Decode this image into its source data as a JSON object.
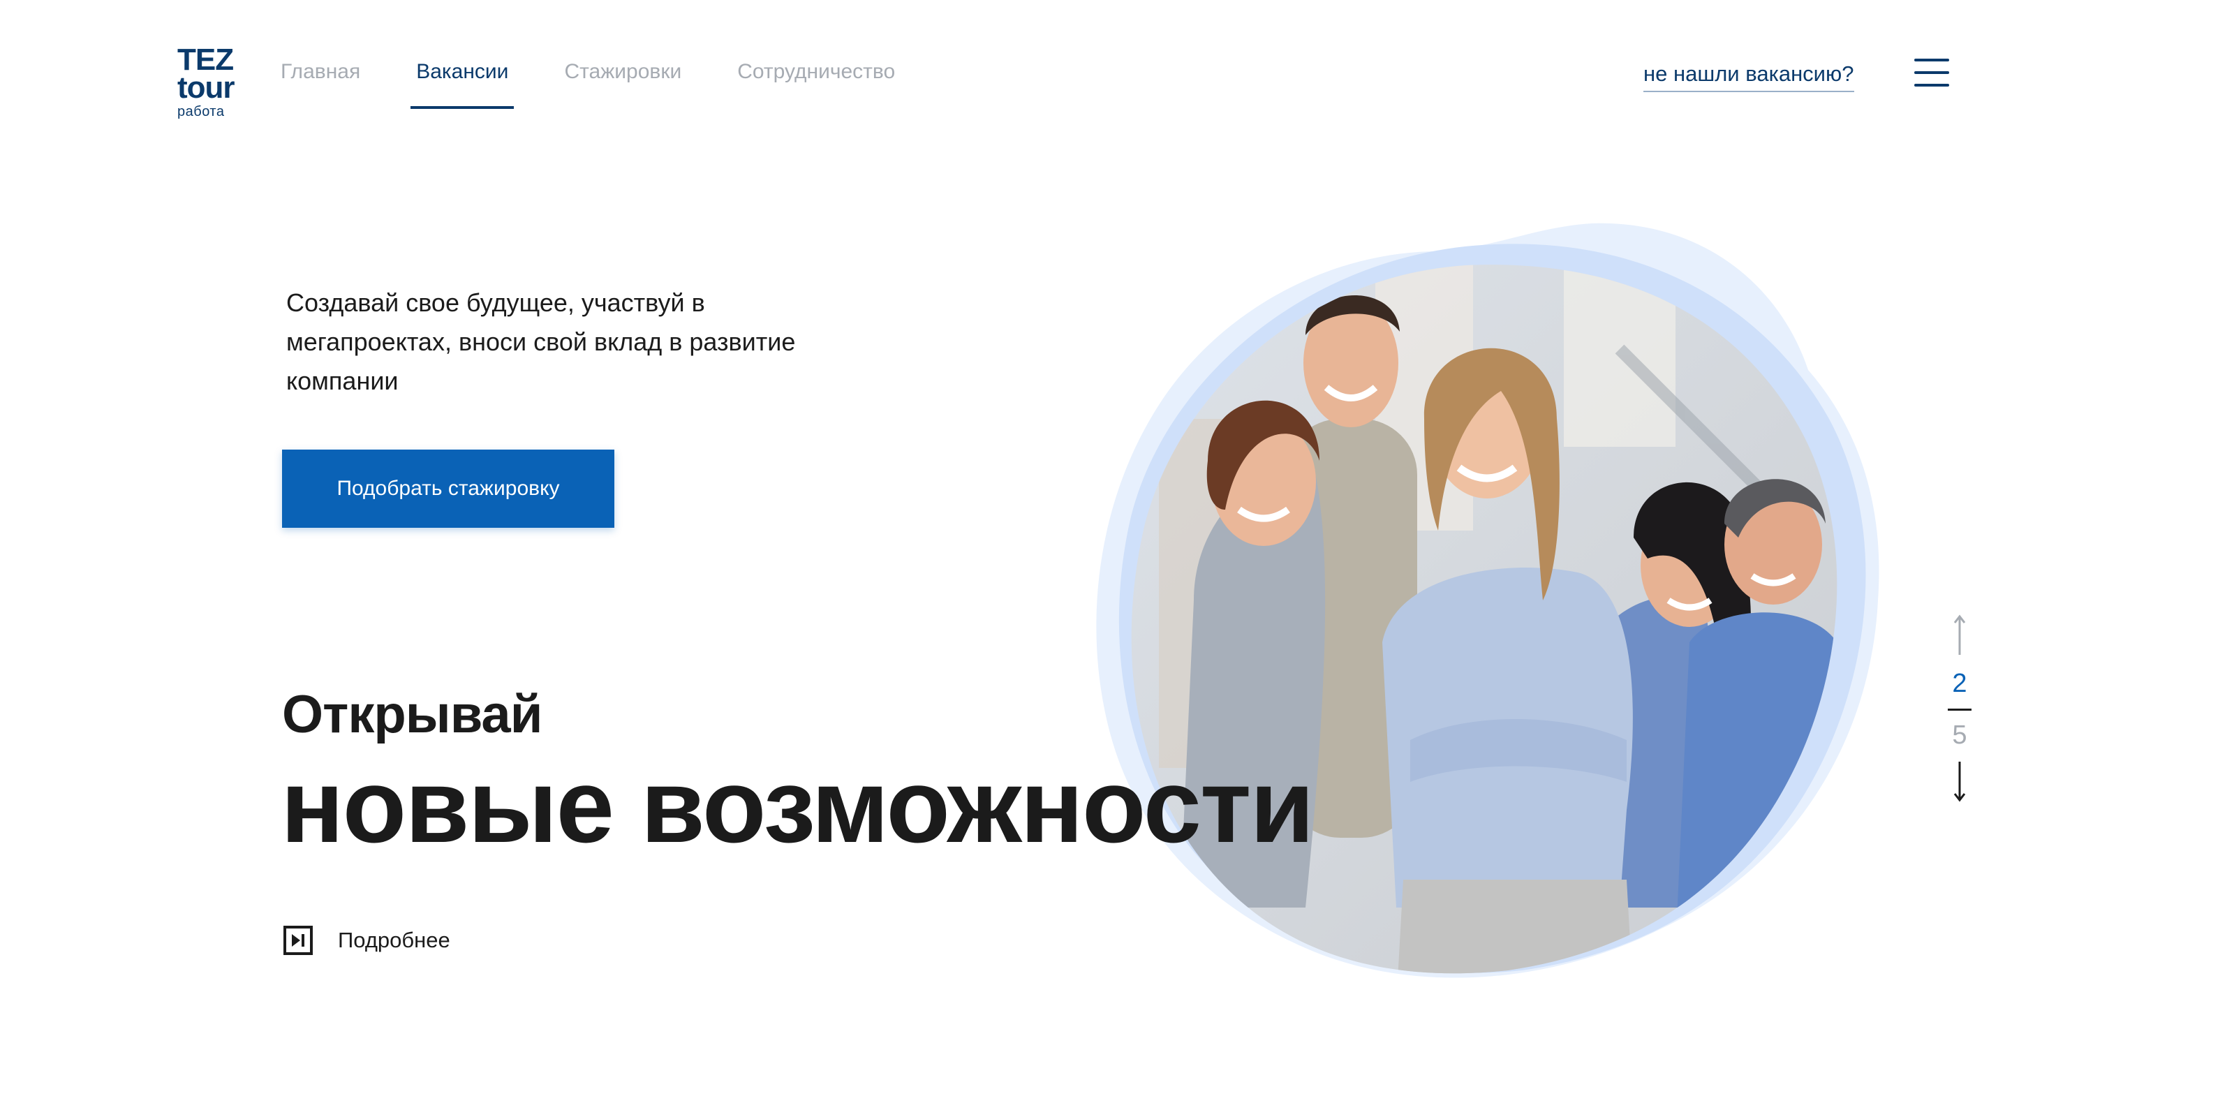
{
  "logo": {
    "line1": "TEZ",
    "line2": "tour",
    "line3": "работа"
  },
  "nav": {
    "items": [
      {
        "label": "Главная",
        "active": false
      },
      {
        "label": "Вакансии",
        "active": true
      },
      {
        "label": "Стажировки",
        "active": false
      },
      {
        "label": "Сотрудничество",
        "active": false
      }
    ]
  },
  "header": {
    "not_found_link": "не нашли вакансию?"
  },
  "hero": {
    "tagline": "Создавай свое будущее, участвуй в мегапроектах, вноси свой вклад в развитие компании",
    "cta_label": "Подобрать стажировку",
    "headline_small": "Открывай",
    "headline_big": "новые возможности",
    "more_label": "Подробнее"
  },
  "pager": {
    "current": "2",
    "total": "5"
  },
  "colors": {
    "brand_dark": "#0b3a6b",
    "brand_blue": "#0a62b6",
    "nav_inactive": "#a6abb2",
    "blob_light": "#e6f0fd",
    "blob_mid": "#cfe0fa"
  },
  "icons": {
    "menu": "hamburger-icon",
    "more": "play-next-icon",
    "pager_up": "arrow-up-icon",
    "pager_down": "arrow-down-icon"
  }
}
